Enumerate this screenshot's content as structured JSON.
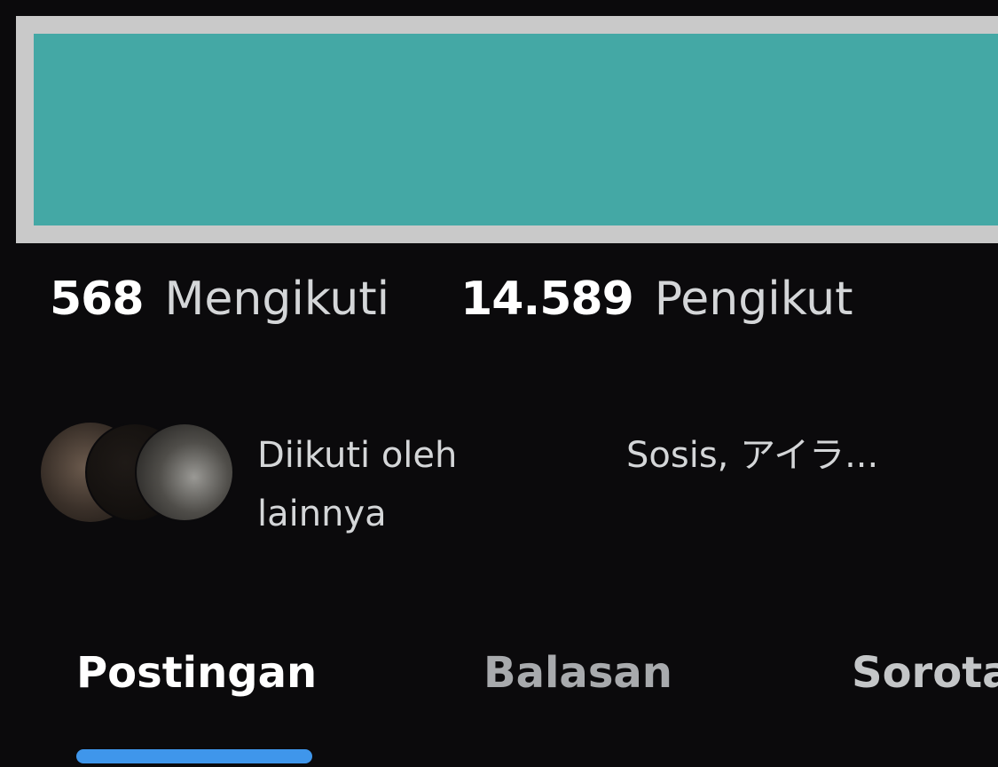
{
  "colors": {
    "banner_border": "#c9c9c9",
    "banner_fill": "#44a8a5",
    "background": "#0b0a0c",
    "tab_indicator": "#3f96eb"
  },
  "stats": {
    "following_count": "568",
    "following_label": "Mengikuti",
    "followers_count": "14.589",
    "followers_label": "Pengikut"
  },
  "followed_by": {
    "line1": "Diikuti oleh",
    "line2": "lainnya",
    "names": "Sosis, アイラ..."
  },
  "tabs": [
    {
      "label": "Postingan",
      "active": true
    },
    {
      "label": "Balasan",
      "active": false
    },
    {
      "label": "Sorota",
      "active": false
    }
  ]
}
